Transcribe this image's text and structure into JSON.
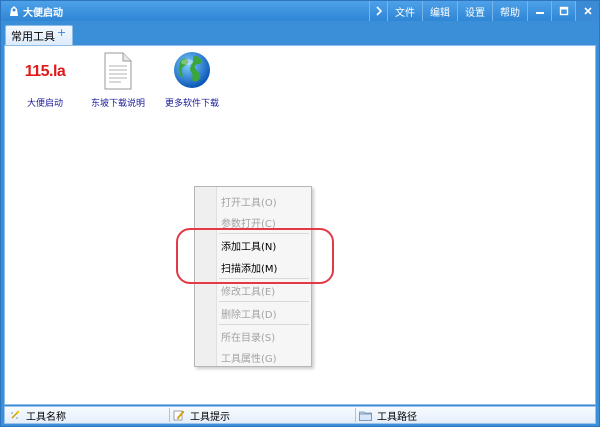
{
  "window": {
    "title": "大便启动",
    "menu": [
      "文件",
      "编辑",
      "设置",
      "帮助"
    ]
  },
  "tabs": [
    {
      "label": "常用工具",
      "add_glyph": "+"
    }
  ],
  "tools": [
    {
      "label": "大便启动",
      "logo_text": "115.la",
      "icon": "115-logo-icon"
    },
    {
      "label": "东坡下载说明",
      "icon": "text-document-icon"
    },
    {
      "label": "更多软件下载",
      "icon": "globe-icon"
    }
  ],
  "context_menu": {
    "items": [
      {
        "label": "打开工具(O)",
        "enabled": false
      },
      {
        "label": "参数打开(C)",
        "enabled": false
      },
      {
        "label": "添加工具(N)",
        "enabled": true
      },
      {
        "label": "扫描添加(M)",
        "enabled": true
      },
      {
        "label": "修改工具(E)",
        "enabled": false
      },
      {
        "label": "删除工具(D)",
        "enabled": false
      },
      {
        "label": "所在目录(S)",
        "enabled": false
      },
      {
        "label": "工具属性(G)",
        "enabled": false
      }
    ]
  },
  "statusbar": {
    "name": "工具名称",
    "hint": "工具提示",
    "path": "工具路径"
  },
  "colors": {
    "chrome_blue": "#3b8fd8",
    "highlight_red": "#e03a46",
    "logo_red": "#e01a1a",
    "label_blue": "#1a1a9a"
  }
}
